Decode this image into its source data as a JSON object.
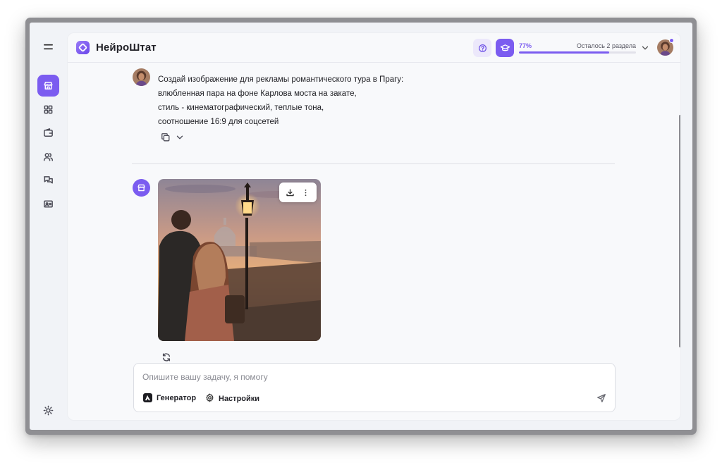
{
  "app": {
    "brand": "НейроШтат",
    "accent_color": "#7b5cf0"
  },
  "sidebar": {
    "items": [
      {
        "icon": "menu-icon"
      },
      {
        "icon": "store-icon",
        "active": true
      },
      {
        "icon": "grid-icon"
      },
      {
        "icon": "wallet-icon"
      },
      {
        "icon": "users-icon"
      },
      {
        "icon": "chat-icon"
      },
      {
        "icon": "id-card-icon"
      },
      {
        "icon": "sun-icon"
      }
    ]
  },
  "header": {
    "progress_percent_label": "77%",
    "progress_value": 77,
    "remaining_label": "Осталось 2 раздела"
  },
  "chat": {
    "user_message_lines": [
      "Создай изображение для рекламы романтического тура в Прагу:",
      "влюбленная пара на фоне Карлова моста на закате,",
      "стиль - кинематографический, теплые тона,",
      "соотношение 16:9 для соцсетей"
    ]
  },
  "composer": {
    "placeholder": "Опишите вашу задачу, я помогу",
    "value": "",
    "generator_label": "Генератор",
    "settings_label": "Настройки"
  }
}
